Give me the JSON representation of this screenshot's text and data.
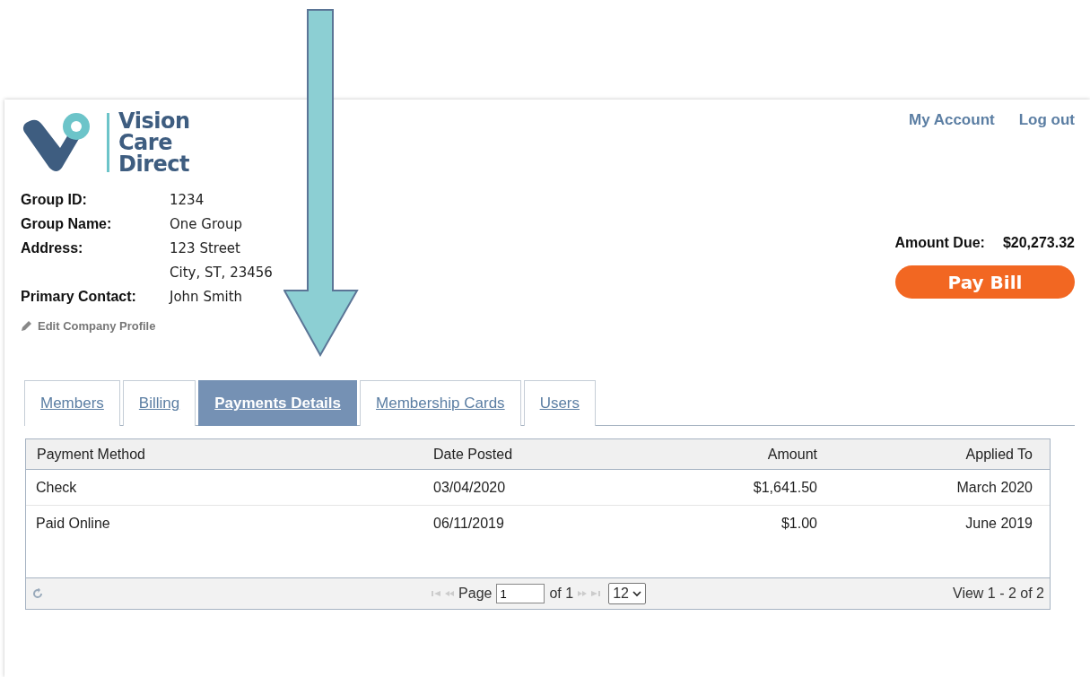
{
  "header": {
    "brand_lines": [
      "Vision",
      "Care",
      "Direct"
    ],
    "links": [
      "My Account",
      "Log out"
    ]
  },
  "group_info": [
    {
      "label": "Group ID:",
      "values": [
        "1234"
      ]
    },
    {
      "label": "Group Name:",
      "values": [
        "One Group"
      ]
    },
    {
      "label": "Address:",
      "values": [
        "123 Street",
        "City, ST, 23456"
      ]
    },
    {
      "label": "Primary Contact:",
      "values": [
        "John Smith"
      ]
    }
  ],
  "edit_link": "Edit Company Profile",
  "amount_due": {
    "label": "Amount Due:",
    "value": "$20,273.32"
  },
  "pay_button": "Pay Bill",
  "tabs": [
    {
      "label": "Members",
      "selected": false
    },
    {
      "label": "Billing",
      "selected": false
    },
    {
      "label": "Payments Details",
      "selected": true
    },
    {
      "label": "Membership Cards",
      "selected": false
    },
    {
      "label": "Users",
      "selected": false
    }
  ],
  "table": {
    "columns": [
      "Payment Method",
      "Date Posted",
      "Amount",
      "Applied To"
    ],
    "rows": [
      [
        "Check",
        "03/04/2020",
        "$1,641.50",
        "March 2020"
      ],
      [
        "Paid Online",
        "06/11/2019",
        "$1.00",
        "June 2019"
      ]
    ]
  },
  "pager": {
    "page_label": "Page",
    "page_value": "1",
    "of_label": "of 1",
    "page_size": "12",
    "view_text": "View 1 - 2 of 2"
  }
}
